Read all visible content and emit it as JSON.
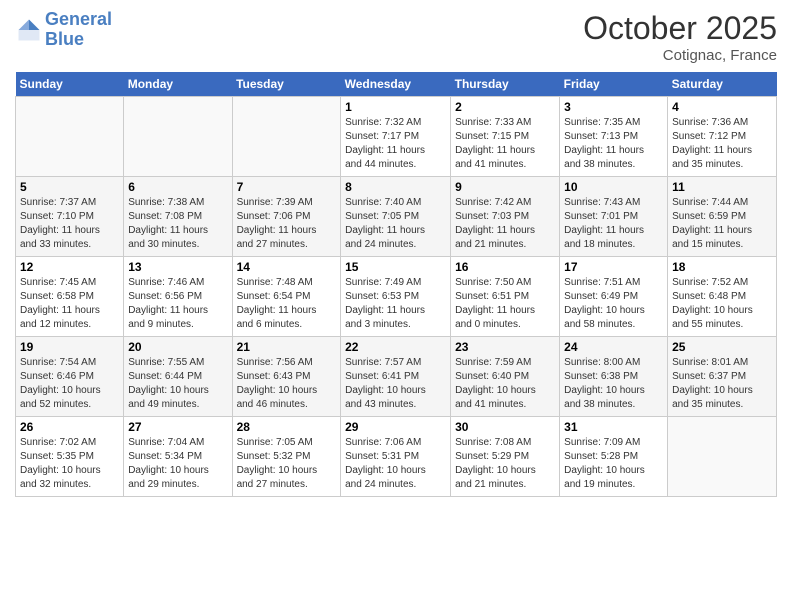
{
  "header": {
    "logo_line1": "General",
    "logo_line2": "Blue",
    "month_title": "October 2025",
    "location": "Cotignac, France"
  },
  "weekdays": [
    "Sunday",
    "Monday",
    "Tuesday",
    "Wednesday",
    "Thursday",
    "Friday",
    "Saturday"
  ],
  "weeks": [
    [
      {
        "day": "",
        "info": ""
      },
      {
        "day": "",
        "info": ""
      },
      {
        "day": "",
        "info": ""
      },
      {
        "day": "1",
        "info": "Sunrise: 7:32 AM\nSunset: 7:17 PM\nDaylight: 11 hours\nand 44 minutes."
      },
      {
        "day": "2",
        "info": "Sunrise: 7:33 AM\nSunset: 7:15 PM\nDaylight: 11 hours\nand 41 minutes."
      },
      {
        "day": "3",
        "info": "Sunrise: 7:35 AM\nSunset: 7:13 PM\nDaylight: 11 hours\nand 38 minutes."
      },
      {
        "day": "4",
        "info": "Sunrise: 7:36 AM\nSunset: 7:12 PM\nDaylight: 11 hours\nand 35 minutes."
      }
    ],
    [
      {
        "day": "5",
        "info": "Sunrise: 7:37 AM\nSunset: 7:10 PM\nDaylight: 11 hours\nand 33 minutes."
      },
      {
        "day": "6",
        "info": "Sunrise: 7:38 AM\nSunset: 7:08 PM\nDaylight: 11 hours\nand 30 minutes."
      },
      {
        "day": "7",
        "info": "Sunrise: 7:39 AM\nSunset: 7:06 PM\nDaylight: 11 hours\nand 27 minutes."
      },
      {
        "day": "8",
        "info": "Sunrise: 7:40 AM\nSunset: 7:05 PM\nDaylight: 11 hours\nand 24 minutes."
      },
      {
        "day": "9",
        "info": "Sunrise: 7:42 AM\nSunset: 7:03 PM\nDaylight: 11 hours\nand 21 minutes."
      },
      {
        "day": "10",
        "info": "Sunrise: 7:43 AM\nSunset: 7:01 PM\nDaylight: 11 hours\nand 18 minutes."
      },
      {
        "day": "11",
        "info": "Sunrise: 7:44 AM\nSunset: 6:59 PM\nDaylight: 11 hours\nand 15 minutes."
      }
    ],
    [
      {
        "day": "12",
        "info": "Sunrise: 7:45 AM\nSunset: 6:58 PM\nDaylight: 11 hours\nand 12 minutes."
      },
      {
        "day": "13",
        "info": "Sunrise: 7:46 AM\nSunset: 6:56 PM\nDaylight: 11 hours\nand 9 minutes."
      },
      {
        "day": "14",
        "info": "Sunrise: 7:48 AM\nSunset: 6:54 PM\nDaylight: 11 hours\nand 6 minutes."
      },
      {
        "day": "15",
        "info": "Sunrise: 7:49 AM\nSunset: 6:53 PM\nDaylight: 11 hours\nand 3 minutes."
      },
      {
        "day": "16",
        "info": "Sunrise: 7:50 AM\nSunset: 6:51 PM\nDaylight: 11 hours\nand 0 minutes."
      },
      {
        "day": "17",
        "info": "Sunrise: 7:51 AM\nSunset: 6:49 PM\nDaylight: 10 hours\nand 58 minutes."
      },
      {
        "day": "18",
        "info": "Sunrise: 7:52 AM\nSunset: 6:48 PM\nDaylight: 10 hours\nand 55 minutes."
      }
    ],
    [
      {
        "day": "19",
        "info": "Sunrise: 7:54 AM\nSunset: 6:46 PM\nDaylight: 10 hours\nand 52 minutes."
      },
      {
        "day": "20",
        "info": "Sunrise: 7:55 AM\nSunset: 6:44 PM\nDaylight: 10 hours\nand 49 minutes."
      },
      {
        "day": "21",
        "info": "Sunrise: 7:56 AM\nSunset: 6:43 PM\nDaylight: 10 hours\nand 46 minutes."
      },
      {
        "day": "22",
        "info": "Sunrise: 7:57 AM\nSunset: 6:41 PM\nDaylight: 10 hours\nand 43 minutes."
      },
      {
        "day": "23",
        "info": "Sunrise: 7:59 AM\nSunset: 6:40 PM\nDaylight: 10 hours\nand 41 minutes."
      },
      {
        "day": "24",
        "info": "Sunrise: 8:00 AM\nSunset: 6:38 PM\nDaylight: 10 hours\nand 38 minutes."
      },
      {
        "day": "25",
        "info": "Sunrise: 8:01 AM\nSunset: 6:37 PM\nDaylight: 10 hours\nand 35 minutes."
      }
    ],
    [
      {
        "day": "26",
        "info": "Sunrise: 7:02 AM\nSunset: 5:35 PM\nDaylight: 10 hours\nand 32 minutes."
      },
      {
        "day": "27",
        "info": "Sunrise: 7:04 AM\nSunset: 5:34 PM\nDaylight: 10 hours\nand 29 minutes."
      },
      {
        "day": "28",
        "info": "Sunrise: 7:05 AM\nSunset: 5:32 PM\nDaylight: 10 hours\nand 27 minutes."
      },
      {
        "day": "29",
        "info": "Sunrise: 7:06 AM\nSunset: 5:31 PM\nDaylight: 10 hours\nand 24 minutes."
      },
      {
        "day": "30",
        "info": "Sunrise: 7:08 AM\nSunset: 5:29 PM\nDaylight: 10 hours\nand 21 minutes."
      },
      {
        "day": "31",
        "info": "Sunrise: 7:09 AM\nSunset: 5:28 PM\nDaylight: 10 hours\nand 19 minutes."
      },
      {
        "day": "",
        "info": ""
      }
    ]
  ]
}
